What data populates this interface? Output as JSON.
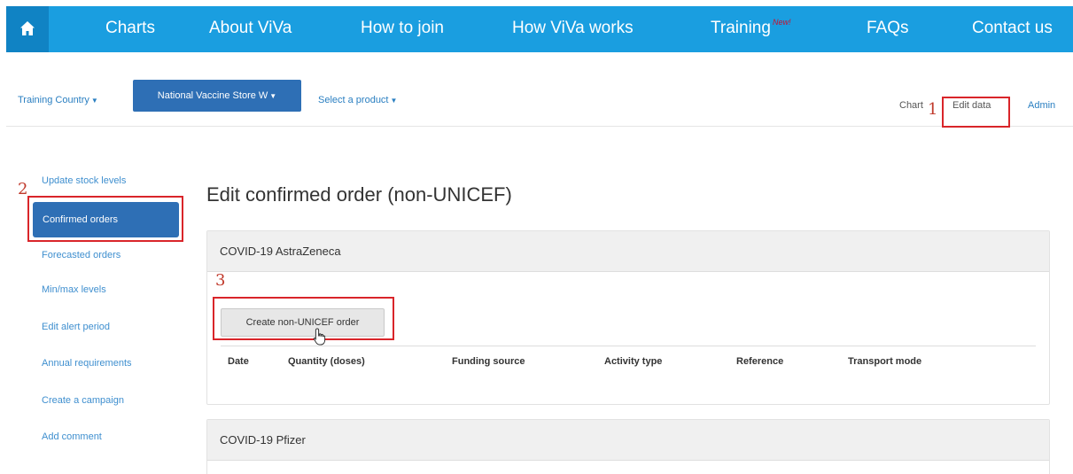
{
  "topnav": {
    "home_icon": "home-icon",
    "items": [
      "Charts",
      "About ViVa",
      "How to join",
      "How ViVa works",
      "Training",
      "FAQs",
      "Contact us"
    ],
    "training_badge": "New!",
    "bg_color": "#1a9ee0",
    "home_bg_color": "#1083c4"
  },
  "subbar": {
    "country": "Training Country",
    "store": "National Vaccine Store W",
    "product": "Select a product",
    "links": {
      "chart": "Chart",
      "edit_data": "Edit data",
      "admin": "Admin"
    }
  },
  "annotations": {
    "one": "1",
    "two": "2",
    "three": "3",
    "color": "#d9252a"
  },
  "sidebar": {
    "items": [
      "Update stock levels",
      "Confirmed orders",
      "Forecasted orders",
      "Min/max levels",
      "Edit alert period",
      "Annual requirements",
      "Create a campaign",
      "Add comment"
    ],
    "active_index": 1,
    "active_color": "#2e6fb5"
  },
  "main": {
    "title": "Edit confirmed order (non-UNICEF)",
    "panels": [
      {
        "header": "COVID-19 AstraZeneca",
        "button": "Create non-UNICEF order",
        "columns": [
          "Date",
          "Quantity (doses)",
          "Funding source",
          "Activity type",
          "Reference",
          "Transport mode"
        ]
      },
      {
        "header": "COVID-19 Pfizer"
      }
    ]
  }
}
